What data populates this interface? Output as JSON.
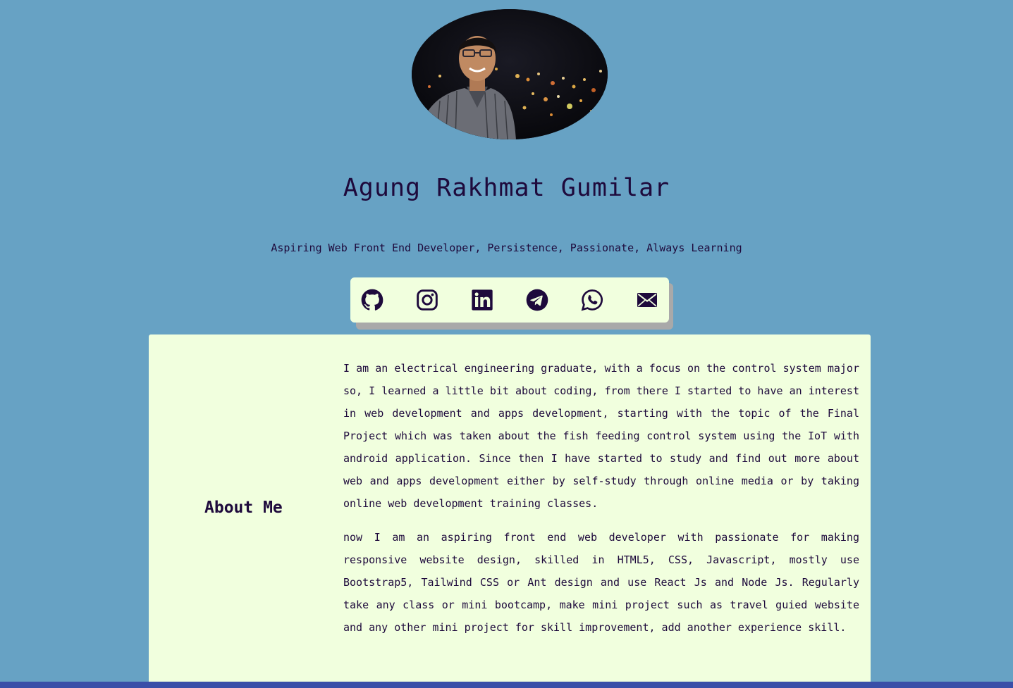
{
  "profile": {
    "name": "Agung Rakhmat Gumilar",
    "tagline": "Aspiring Web Front End Developer, Persistence, Passionate, Always Learning"
  },
  "social_links": [
    {
      "icon": "github-icon"
    },
    {
      "icon": "instagram-icon"
    },
    {
      "icon": "linkedin-icon"
    },
    {
      "icon": "telegram-icon"
    },
    {
      "icon": "whatsapp-icon"
    },
    {
      "icon": "mail-icon"
    }
  ],
  "about": {
    "title": "About Me",
    "paragraphs": [
      "I am an electrical engineering graduate, with a focus on the control system major so, I learned a little bit about coding, from there I started to have an interest in web development and apps development, starting with the topic of the Final Project which was taken about the fish feeding control system using the IoT with android application. Since then I have started to study and find out more about web and apps development either by self-study through online media or by taking online web development training classes.",
      "now I am an aspiring front end web developer with passionate for making responsive website design, skilled in HTML5, CSS, Javascript, mostly use Bootstrap5, Tailwind CSS or Ant design and use React Js and Node Js. Regularly take any class or mini bootcamp, make mini project such as travel guied website and any other mini project for skill improvement, add another experience skill."
    ]
  },
  "colors": {
    "background": "#67a2c4",
    "card": "#f1ffde",
    "text": "#1e0a3c",
    "bottom_bar": "#3a4fa8"
  }
}
